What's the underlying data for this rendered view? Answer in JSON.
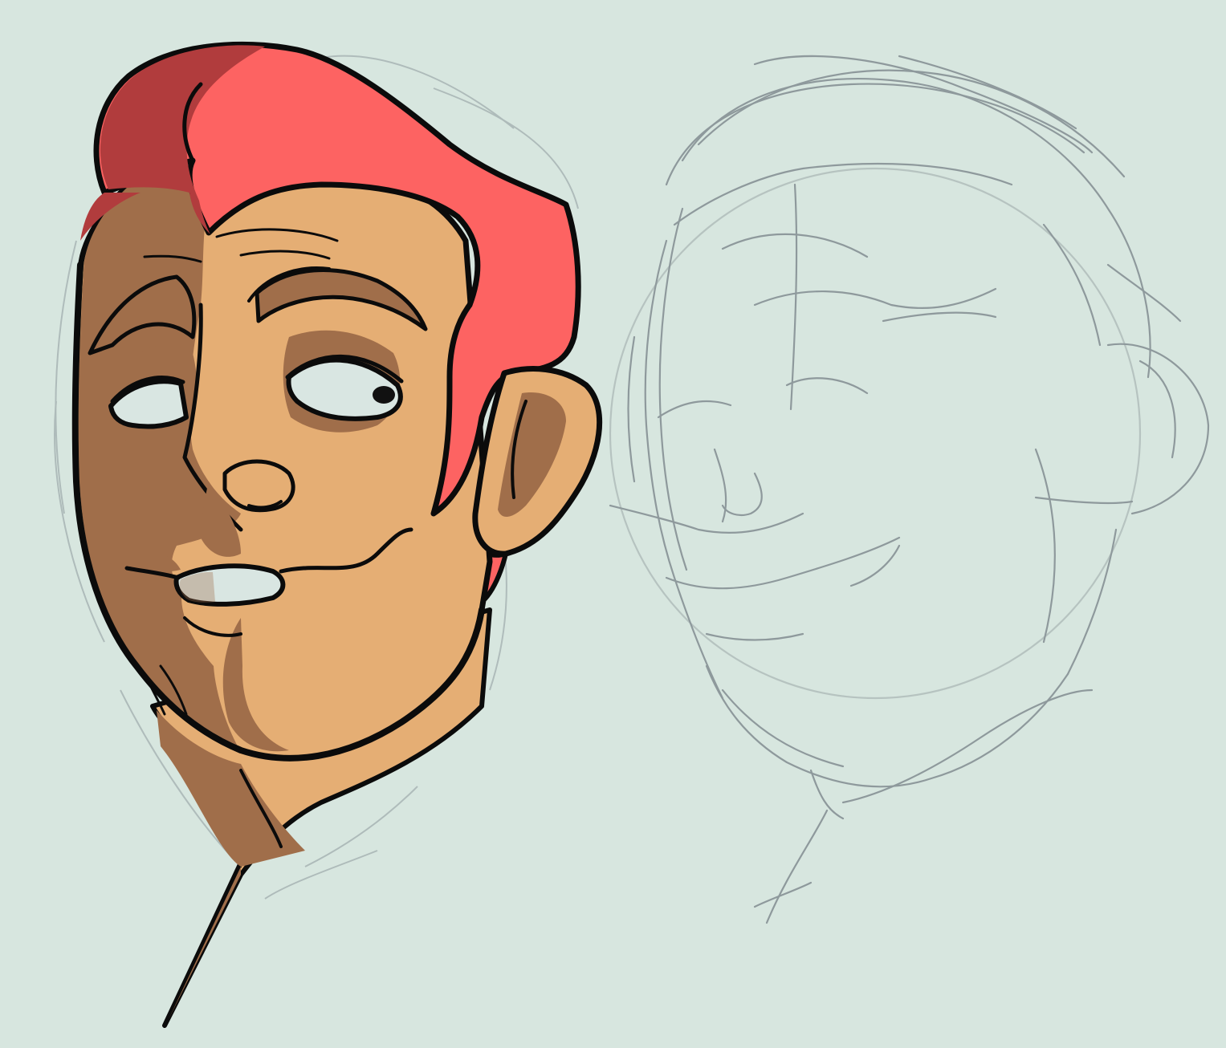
{
  "artwork": {
    "colors": {
      "background": "#d7e6df",
      "outline": "#0b0b0b",
      "hair_light": "#fd6362",
      "hair_shadow": "#b13c3d",
      "skin_light": "#e5ae74",
      "skin_shadow": "#a06e4a",
      "eye_white": "#d9e6e2",
      "pupil": "#111111",
      "sketch_line": "#8e999c"
    },
    "panels": [
      {
        "id": "colored-head",
        "style": "inked-and-colored"
      },
      {
        "id": "sketch-head",
        "style": "rough-pencil-sketch"
      }
    ]
  }
}
